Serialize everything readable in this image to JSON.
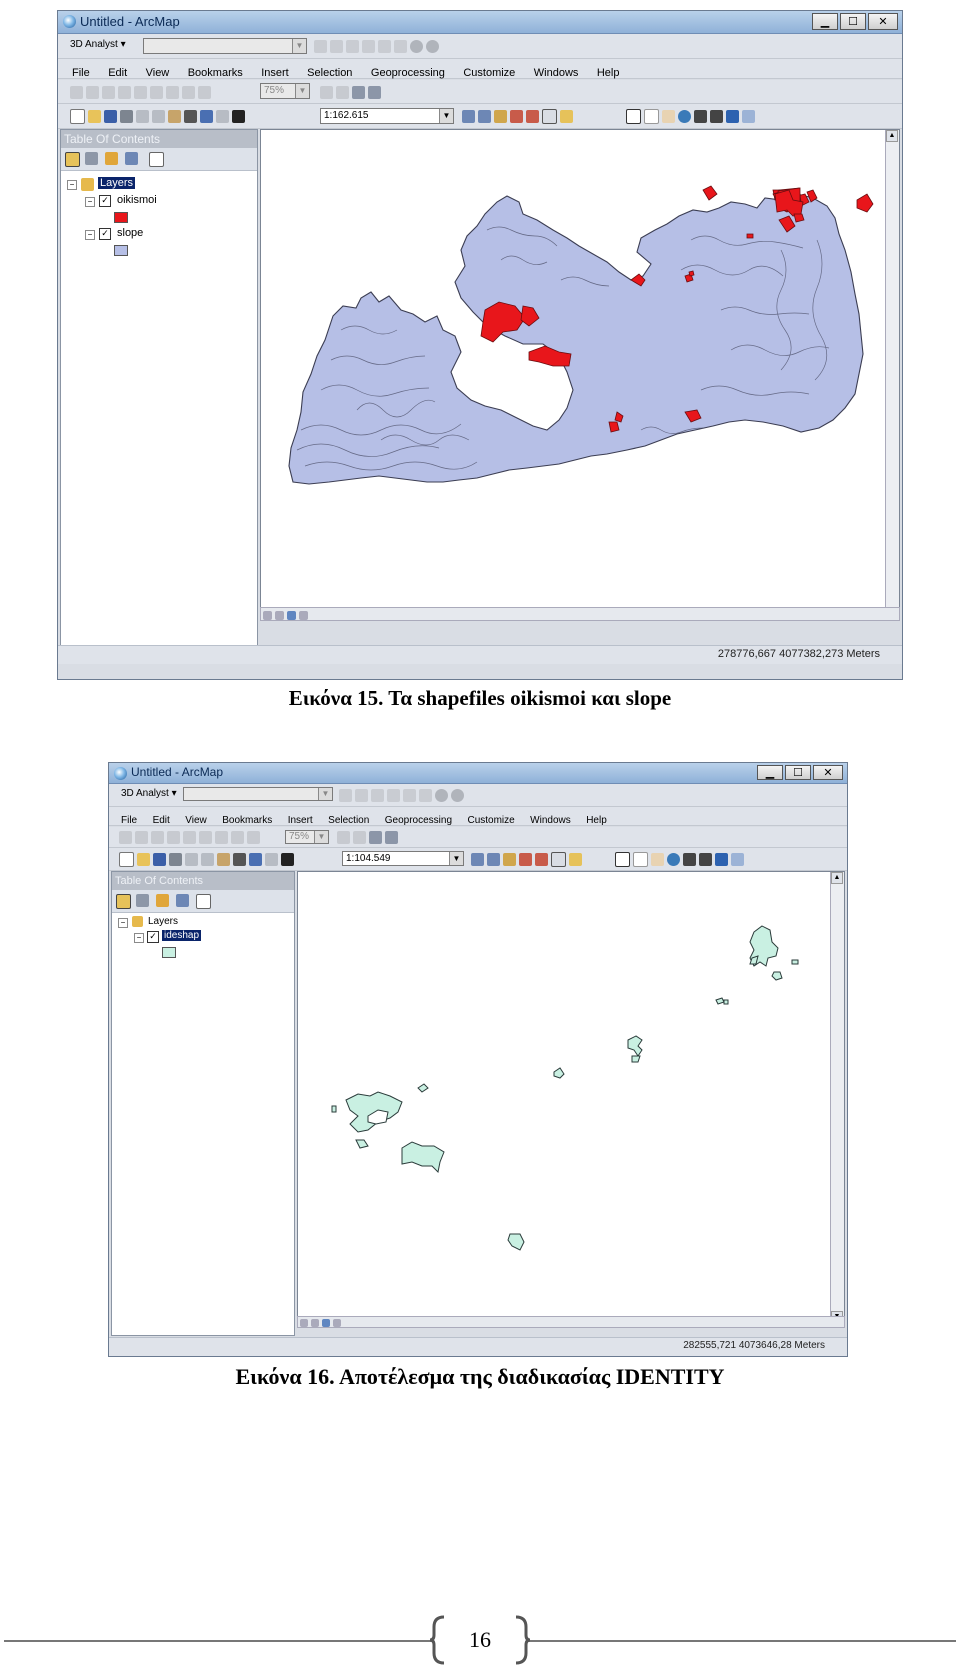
{
  "figure1": {
    "window_title": "Untitled - ArcMap",
    "toolbar1": {
      "dropdown_label": "3D Analyst ▾"
    },
    "menu": [
      "File",
      "Edit",
      "View",
      "Bookmarks",
      "Insert",
      "Selection",
      "Geoprocessing",
      "Customize",
      "Windows",
      "Help"
    ],
    "zoom_combo": "75%",
    "scale_value": "1:162.615",
    "toc_title": "Table Of Contents",
    "layers_root": "Layers",
    "layers": [
      {
        "name": "oikismoi",
        "checked": true,
        "swatch_color": "#e8161b"
      },
      {
        "name": "slope",
        "checked": true,
        "swatch_color": "#b6bfe6"
      }
    ],
    "status_coords": "278776,667  4077382,273 Meters",
    "caption": "Εικόνα 15. Τα shapefiles oikismoi και slope"
  },
  "figure2": {
    "window_title": "Untitled - ArcMap",
    "toolbar1": {
      "dropdown_label": "3D Analyst ▾"
    },
    "menu": [
      "File",
      "Edit",
      "View",
      "Bookmarks",
      "Insert",
      "Selection",
      "Geoprocessing",
      "Customize",
      "Windows",
      "Help"
    ],
    "zoom_combo": "75%",
    "scale_value": "1:104.549",
    "toc_title": "Table Of Contents",
    "layers_root": "Layers",
    "layers": [
      {
        "name": "ideshap",
        "checked": true,
        "selected": true,
        "swatch_color": "#c9f0e2"
      }
    ],
    "status_coords": "282555,721  4073646,28 Meters",
    "caption": "Εικόνα 16. Αποτέλεσμα της διαδικασίας IDENTITY"
  },
  "page_number": "16",
  "colors": {
    "slope_fill": "#b6bfe6",
    "oikismoi_fill": "#e8161b",
    "ideshap_fill": "#c9f0e2"
  }
}
